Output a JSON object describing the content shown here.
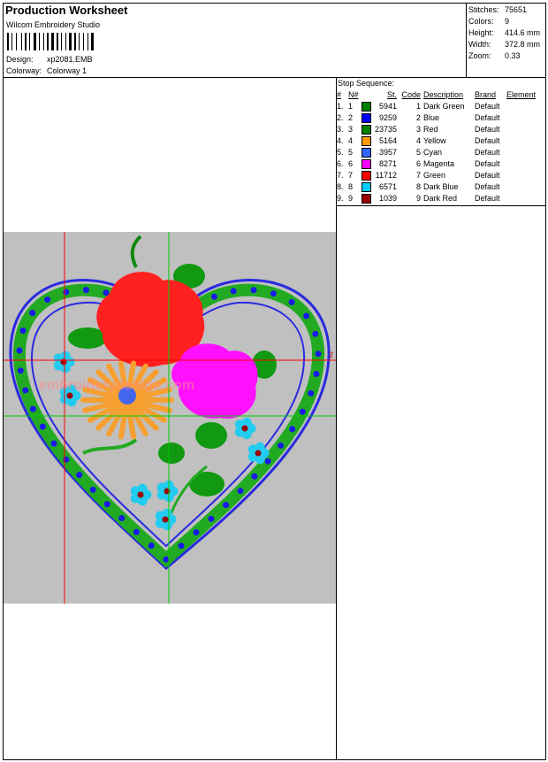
{
  "header": {
    "title": "Production Worksheet",
    "company": "Wilcom Embroidery Studio",
    "design_label": "Design:",
    "design_value": "xp2081.EMB",
    "colorway_label": "Colorway:",
    "colorway_value": "Colorway 1"
  },
  "stats": [
    {
      "label": "Stitches:",
      "value": "75651"
    },
    {
      "label": "Colors:",
      "value": "9"
    },
    {
      "label": "Height:",
      "value": "414.6 mm"
    },
    {
      "label": "Width:",
      "value": "372.8 mm"
    },
    {
      "label": "Zoom:",
      "value": "0.33"
    }
  ],
  "stop_sequence": {
    "title": "Stop Sequence:",
    "columns": [
      "#",
      "N#",
      "St.",
      "Code",
      "Description",
      "Brand",
      "Element"
    ],
    "rows": [
      {
        "num": "1.",
        "n": "1",
        "color": "#008000",
        "st": "5941",
        "code": "1",
        "desc": "Dark Green",
        "brand": "Default"
      },
      {
        "num": "2.",
        "n": "2",
        "color": "#0000ff",
        "st": "9259",
        "code": "2",
        "desc": "Blue",
        "brand": "Default"
      },
      {
        "num": "3.",
        "n": "3",
        "color": "#008000",
        "st": "23735",
        "code": "3",
        "desc": "Red",
        "brand": "Default"
      },
      {
        "num": "4.",
        "n": "4",
        "color": "#ff9900",
        "st": "5164",
        "code": "4",
        "desc": "Yellow",
        "brand": "Default"
      },
      {
        "num": "5.",
        "n": "5",
        "color": "#3366ff",
        "st": "3957",
        "code": "5",
        "desc": "Cyan",
        "brand": "Default"
      },
      {
        "num": "6.",
        "n": "6",
        "color": "#ff00ff",
        "st": "8271",
        "code": "6",
        "desc": "Magenta",
        "brand": "Default"
      },
      {
        "num": "7.",
        "n": "7",
        "color": "#ff0000",
        "st": "11712",
        "code": "7",
        "desc": "Green",
        "brand": "Default"
      },
      {
        "num": "8.",
        "n": "8",
        "color": "#00ccff",
        "st": "6571",
        "code": "8",
        "desc": "Dark Blue",
        "brand": "Default"
      },
      {
        "num": "9.",
        "n": "9",
        "color": "#990000",
        "st": "1039",
        "code": "9",
        "desc": "Dark Red",
        "brand": "Default"
      }
    ]
  },
  "watermark": "embroiderydesign.com",
  "marker_label": "2"
}
